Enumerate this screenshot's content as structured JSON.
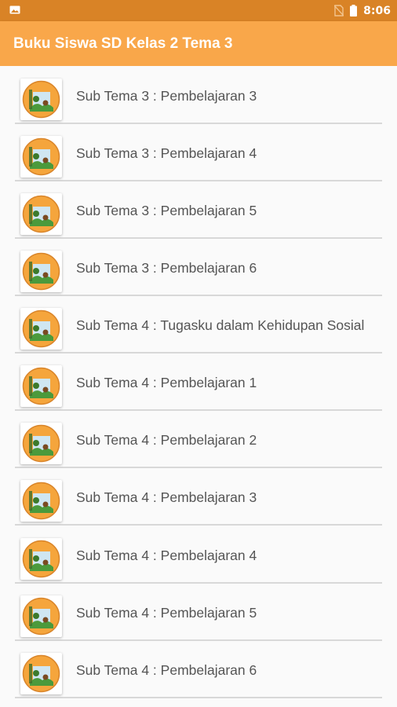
{
  "status_bar": {
    "time": "8:06",
    "icons": [
      "image-icon",
      "no-sim-icon",
      "battery-icon"
    ]
  },
  "app_bar": {
    "title": "Buku Siswa SD Kelas 2 Tema 3",
    "color": "#f9a74a"
  },
  "list": {
    "items": [
      {
        "label": "Sub Tema 3 : Pembelajaran 3"
      },
      {
        "label": "Sub Tema 3 : Pembelajaran 4"
      },
      {
        "label": "Sub Tema 3 : Pembelajaran 5"
      },
      {
        "label": "Sub Tema 3 : Pembelajaran 6"
      },
      {
        "label": "Sub Tema 4 : Tugasku dalam Kehidupan Sosial"
      },
      {
        "label": "Sub Tema 4 : Pembelajaran 1"
      },
      {
        "label": "Sub Tema 4 : Pembelajaran 2"
      },
      {
        "label": "Sub Tema 4 : Pembelajaran 3"
      },
      {
        "label": "Sub Tema 4 : Pembelajaran 4"
      },
      {
        "label": "Sub Tema 4 : Pembelajaran 5"
      },
      {
        "label": "Sub Tema 4 : Pembelajaran 6"
      }
    ],
    "item_icon": "book-cover-icon"
  }
}
